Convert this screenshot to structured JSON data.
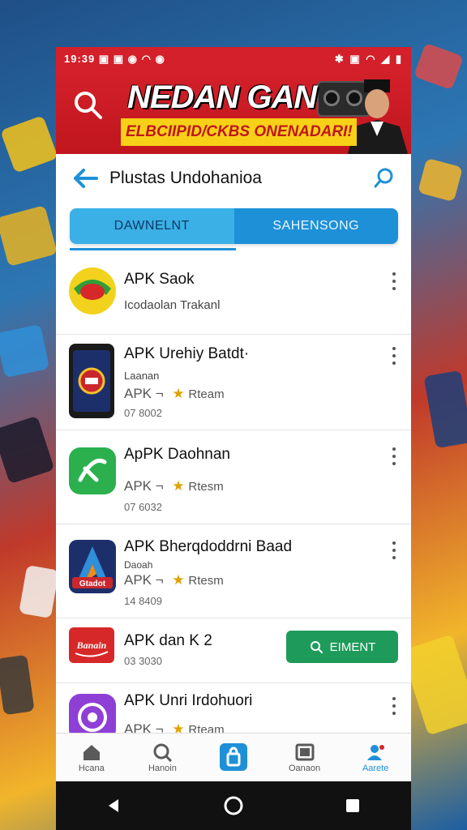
{
  "status_bar": {
    "time_and_icons": "19:39 ▣ ▣ ◉ ◠ ◉",
    "right_icons": "✱ ▣ ◠ ◢ ▮"
  },
  "banner": {
    "title": "NEDAN GAN",
    "subtitle": "ELBCIIPID/CKBS ONENADARI!"
  },
  "header": {
    "title": "Plustas Undohanioa"
  },
  "tabs": [
    {
      "label": "DAWNELNT",
      "active": true
    },
    {
      "label": "SAHENSONG",
      "active": false
    }
  ],
  "apps": [
    {
      "name": "APK Saok",
      "subtitle": "Icodaolan Trakanl"
    },
    {
      "name": "APK Urehiy Batdt·",
      "subtitle": "Laanan",
      "meta_prefix": "APK ¬",
      "rating": "Rteam",
      "size": "07 8002"
    },
    {
      "name": "ApPK Daohnan",
      "meta_prefix": "APK ¬",
      "rating": "Rtesm",
      "size": "07 6032"
    },
    {
      "name": "APK Bherqdoddrni Baad",
      "subtitle": "Daoah",
      "meta_prefix": "APK ¬",
      "rating": "Rtesm",
      "size": "14 8409"
    },
    {
      "name": "APK dan K 2",
      "size": "03 3030",
      "install_label": "EIMENT"
    },
    {
      "name": "APK Unri Irdohuori",
      "meta_prefix": "APK ¬",
      "rating": "Rteam"
    }
  ],
  "icon_texts": {
    "app4": "Gtadot",
    "app5": "Banain"
  },
  "bottom_nav": [
    {
      "label": "Hcana",
      "icon": "home-icon"
    },
    {
      "label": "Hanoin",
      "icon": "search-icon"
    },
    {
      "label": "",
      "icon": "store-icon"
    },
    {
      "label": "Oanaon",
      "icon": "library-icon"
    },
    {
      "label": "Aarete",
      "icon": "account-icon",
      "active": true
    }
  ],
  "colors": {
    "accent": "#1e90d8",
    "banner_red": "#d3202a",
    "install_green": "#1e9b5a"
  }
}
